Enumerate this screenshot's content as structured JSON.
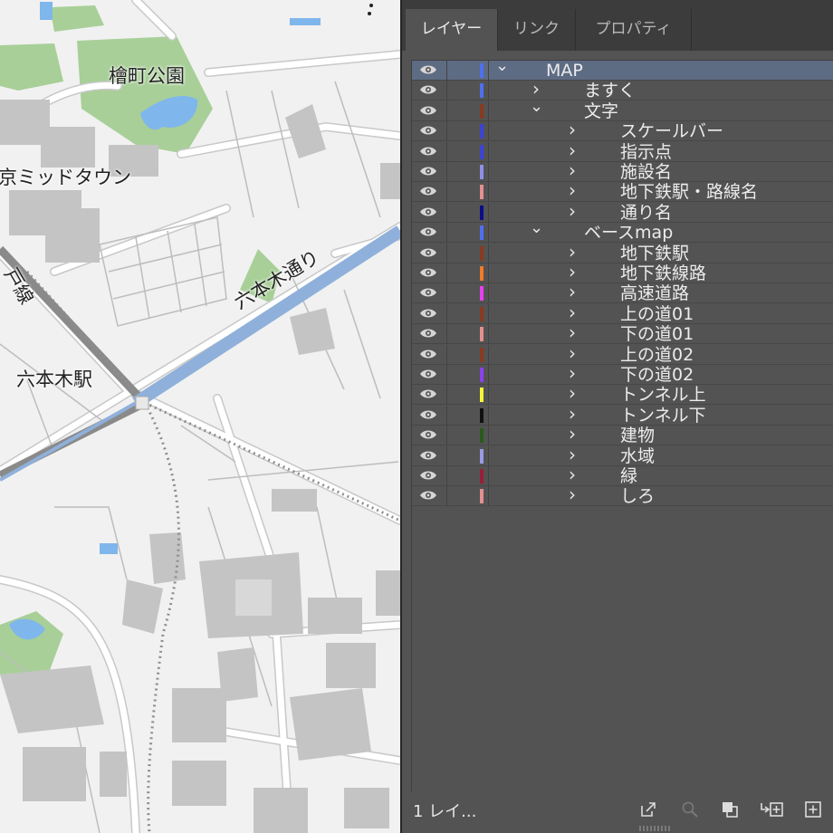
{
  "map": {
    "labels": {
      "park": "檜町公園",
      "midtown": "京ミッドタウン",
      "avenue": "六本木通り",
      "line": "戸線",
      "station": "六本木駅"
    }
  },
  "panel": {
    "tabs": [
      "レイヤー",
      "リンク",
      "プロパティ"
    ],
    "active_tab": "レイヤー",
    "layers": [
      {
        "name": "MAP",
        "level": 0,
        "expanded": true,
        "color": "#4f6ff0",
        "selected": true
      },
      {
        "name": "ますく",
        "level": 1,
        "expanded": false,
        "color": "#4f6ff0"
      },
      {
        "name": "文字",
        "level": 1,
        "expanded": true,
        "color": "#8a3a1e"
      },
      {
        "name": "スケールバー",
        "level": 2,
        "expanded": false,
        "color": "#3c42d8"
      },
      {
        "name": "指示点",
        "level": 2,
        "expanded": false,
        "color": "#3c42d8"
      },
      {
        "name": "施設名",
        "level": 2,
        "expanded": false,
        "color": "#8f8fe8"
      },
      {
        "name": "地下鉄駅・路線名",
        "level": 2,
        "expanded": false,
        "color": "#e58f8f"
      },
      {
        "name": "通り名",
        "level": 2,
        "expanded": false,
        "color": "#0c0c88"
      },
      {
        "name": "ベースmap",
        "level": 1,
        "expanded": true,
        "color": "#4f6ff0"
      },
      {
        "name": "地下鉄駅",
        "level": 2,
        "expanded": false,
        "color": "#8a3a1e"
      },
      {
        "name": "地下鉄線路",
        "level": 2,
        "expanded": false,
        "color": "#f07a28"
      },
      {
        "name": "高速道路",
        "level": 2,
        "expanded": false,
        "color": "#e83ff0"
      },
      {
        "name": "上の道01",
        "level": 2,
        "expanded": false,
        "color": "#8a3a1e"
      },
      {
        "name": "下の道01",
        "level": 2,
        "expanded": false,
        "color": "#e58f8f"
      },
      {
        "name": "上の道02",
        "level": 2,
        "expanded": false,
        "color": "#8a3a1e"
      },
      {
        "name": "下の道02",
        "level": 2,
        "expanded": false,
        "color": "#8e3ff0"
      },
      {
        "name": "トンネル上",
        "level": 2,
        "expanded": false,
        "color": "#f7f73a"
      },
      {
        "name": "トンネル下",
        "level": 2,
        "expanded": false,
        "color": "#111111"
      },
      {
        "name": "建物",
        "level": 2,
        "expanded": false,
        "color": "#2a5a1a"
      },
      {
        "name": "水域",
        "level": 2,
        "expanded": false,
        "color": "#9a9ae8"
      },
      {
        "name": "緑",
        "level": 2,
        "expanded": false,
        "color": "#9a1e3a"
      },
      {
        "name": "しろ",
        "level": 2,
        "expanded": false,
        "color": "#e58f8f"
      }
    ],
    "footer": {
      "layer_count": "1 レイ...",
      "icons": [
        "export-icon",
        "search-icon",
        "clipping-mask-icon",
        "move-to-layer-icon",
        "new-layer-icon"
      ]
    }
  }
}
